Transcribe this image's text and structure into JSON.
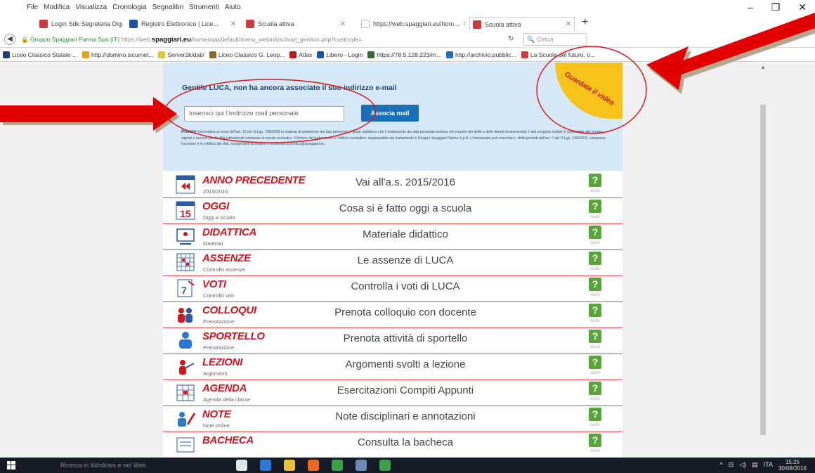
{
  "menubar": {
    "items": [
      "File",
      "Modifica",
      "Visualizza",
      "Cronologia",
      "Segnalibri",
      "Strumenti",
      "Aiuto"
    ],
    "window_controls": [
      "–",
      "❐",
      "✕"
    ]
  },
  "tabs": [
    {
      "label": "Login Sdk Segreteria Digit...",
      "color": "#d13a3a"
    },
    {
      "label": "Registro Elettronico | Lice...",
      "color": "#1d4ea3"
    },
    {
      "label": "Scuola attiva",
      "color": "#d13a3a"
    },
    {
      "label": "https://web.spaggiari.eu/hom...",
      "color": "#ffffff"
    },
    {
      "label": "Scuola attiva",
      "color": "#d13a3a",
      "active": true
    }
  ],
  "navbar": {
    "site_label": "Gruppo Spaggiari Parma Spa (IT)",
    "url_prefix": "https://web.",
    "url_domain": "spaggiari.eu",
    "url_path": "/home/app/default/menu_webinfoschool_genitori.php?custcode=",
    "search_placeholder": "Cerca"
  },
  "bookmarks": [
    {
      "label": "Liceo Classico Statale ...",
      "color": "#1d3f70"
    },
    {
      "label": "http://domino.sicurnet...",
      "color": "#e8a21a"
    },
    {
      "label": "Server2k/dati/",
      "color": "#e8c23a"
    },
    {
      "label": "Liceo Classico G. Leop...",
      "color": "#8a6a2a"
    },
    {
      "label": "Atlas",
      "color": "#c41616"
    },
    {
      "label": "Libero - Login",
      "color": "#1d4ea3"
    },
    {
      "label": "https://78.5.128.223/m...",
      "color": "#3a6a3a"
    },
    {
      "label": "http://archivio.pubblic...",
      "color": "#1d6fb8"
    },
    {
      "label": "La Scuola del futuro, o...",
      "color": "#d13a3a"
    }
  ],
  "email": {
    "title": "Gentile LUCA, non ha ancora associato il suo indirizzo e-mail",
    "placeholder": "Inserisci qui l'indirizzo mail personale",
    "button": "Associa mail",
    "privacy_label": "Privacy",
    "privacy_text": "Informativa ai sensi dell'art. 13 del D.Lgs. 196/2003 in materia di protezione dei dati personali, il quale stabilisce che il trattamento dei dati personali avviene nel rispetto dei diritti e delle libertà fondamentali. I dati vengono trattati in conformità alle norme vigenti e raccolti per finalità istituzionali connesse ai servizi scolastici. Il titolare del trattamento è l'istituto scolastico; responsabile del trattamento è Gruppo Spaggiari Parma S.p.A. L'interessato può esercitare i diritti previsti dall'art. 7 del D.Lgs. 196/2003, compreso l'accesso e la rettifica dei dati, rivolgendosi al titolare o scrivendo a privacy@spaggiari.eu"
  },
  "video_badge": {
    "label": "Guardate il video"
  },
  "menu": [
    {
      "title": "ANNO PRECEDENTE",
      "sub": "2015/2016",
      "desc": "Vai all'a.s. 2015/2016",
      "icon": "back-calendar-icon"
    },
    {
      "title": "OGGI",
      "sub": "Oggi a scuola",
      "desc": "Cosa si è fatto oggi a scuola",
      "icon": "calendar-15-icon"
    },
    {
      "title": "DIDATTICA",
      "sub": "Materiali",
      "desc": "Materiale didattico",
      "icon": "whiteboard-icon"
    },
    {
      "title": "ASSENZE",
      "sub": "Controllo assenze",
      "desc": "Le assenze di LUCA",
      "icon": "calendar-grid-icon"
    },
    {
      "title": "VOTI",
      "sub": "Controllo voti",
      "desc": "Controlla i voti di LUCA",
      "icon": "grade-sheet-icon"
    },
    {
      "title": "COLLOQUI",
      "sub": "Prenotazione",
      "desc": "Prenota colloquio con docente",
      "icon": "meeting-people-icon"
    },
    {
      "title": "SPORTELLO",
      "sub": "Prenotazione",
      "desc": "Prenota attività di sportello",
      "icon": "person-desk-icon"
    },
    {
      "title": "LEZIONI",
      "sub": "Argomenti",
      "desc": "Argomenti svolti a lezione",
      "icon": "teacher-icon"
    },
    {
      "title": "AGENDA",
      "sub": "Agenda della classe",
      "desc": "Esercitazioni Compiti Appunti",
      "icon": "agenda-icon"
    },
    {
      "title": "NOTE",
      "sub": "Note online",
      "desc": "Note disciplinari e annotazioni",
      "icon": "note-person-icon"
    },
    {
      "title": "BACHECA",
      "sub": "",
      "desc": "Consulta la bacheca",
      "icon": "board-icon"
    }
  ],
  "help_label": "Aiuto",
  "taskbar": {
    "search_placeholder": "Ricerca in Windows e nel Web",
    "time": "15:25",
    "date": "30/09/2016",
    "lang": "ITA"
  },
  "colors": {
    "accent_red": "#d4141e",
    "panel_blue": "#d6e7f6",
    "button_blue": "#1b6fb8",
    "help_green": "#5aa53a",
    "badge_yellow": "#f7c21a"
  }
}
